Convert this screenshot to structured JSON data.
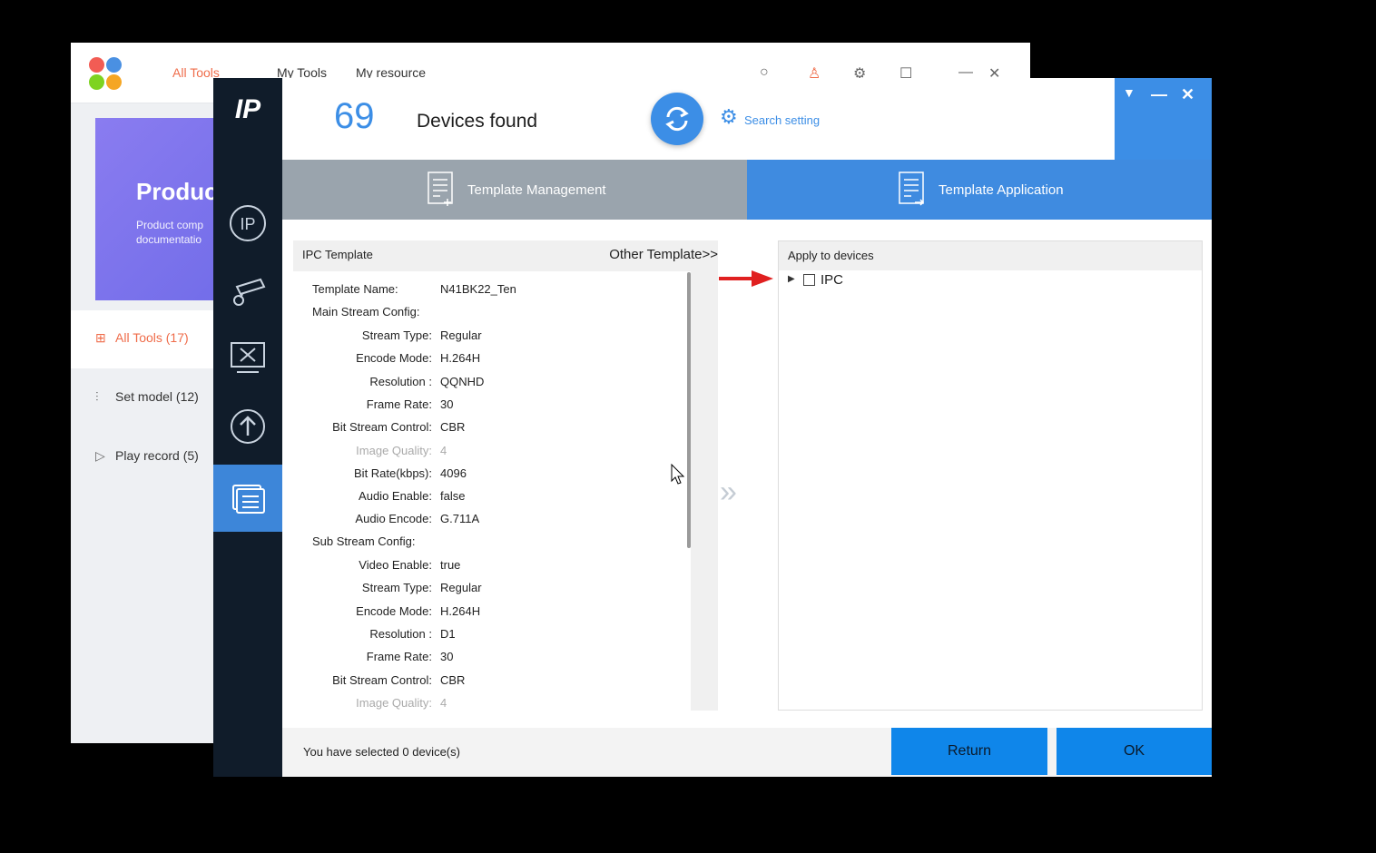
{
  "bg_app": {
    "tabs": [
      "All Tools",
      "My Tools",
      "My resource"
    ],
    "banner_title": "Produc",
    "banner_text": "Product comp documentatio",
    "nav": [
      {
        "icon": "grid-icon",
        "label": "All Tools (17)"
      },
      {
        "icon": "sliders-icon",
        "label": "Set model (12)"
      },
      {
        "icon": "play-icon",
        "label": "Play record (5)"
      }
    ]
  },
  "sidebar": {
    "logo": "IP",
    "items": [
      "ip-icon",
      "camera-icon",
      "tools-icon",
      "upgrade-icon",
      "template-icon"
    ],
    "active_index": 4
  },
  "header": {
    "count": "69",
    "label": "Devices found",
    "search_setting": "Search setting"
  },
  "tabs": {
    "management": "Template Management",
    "application": "Template Application"
  },
  "template_panel": {
    "title": "IPC Template",
    "other": "Other Template>>",
    "name_label": "Template Name:",
    "name_value": "N41BK22_Ten",
    "main_section": "Main Stream Config:",
    "main_rows": [
      {
        "k": "Stream Type:",
        "v": "Regular"
      },
      {
        "k": "Encode Mode:",
        "v": "H.264H"
      },
      {
        "k": "Resolution :",
        "v": "QQNHD"
      },
      {
        "k": "Frame Rate:",
        "v": "30"
      },
      {
        "k": "Bit Stream Control:",
        "v": "CBR"
      },
      {
        "k": "Image Quality:",
        "v": "4"
      },
      {
        "k": "Bit Rate(kbps):",
        "v": "4096"
      },
      {
        "k": "Audio Enable:",
        "v": "false"
      },
      {
        "k": "Audio Encode:",
        "v": "G.711A"
      }
    ],
    "sub_section": "Sub Stream Config:",
    "sub_rows": [
      {
        "k": "Video Enable:",
        "v": "true"
      },
      {
        "k": "Stream Type:",
        "v": "Regular"
      },
      {
        "k": "Encode Mode:",
        "v": "H.264H"
      },
      {
        "k": "Resolution :",
        "v": "D1"
      },
      {
        "k": "Frame Rate:",
        "v": "30"
      },
      {
        "k": "Bit Stream Control:",
        "v": "CBR"
      },
      {
        "k": "Image Quality:",
        "v": "4"
      }
    ]
  },
  "apply_panel": {
    "title": "Apply to devices",
    "tree": [
      {
        "label": "IPC",
        "checked": false
      }
    ]
  },
  "footer": {
    "status": "You have selected 0 device(s)",
    "return_label": "Return",
    "ok_label": "OK"
  },
  "colors": {
    "accent": "#3c8ee6",
    "sidebar": "#101c2a",
    "button": "#0f86ea",
    "tab_inactive": "#9aa4ad",
    "highlight_arrow": "#e02020"
  }
}
